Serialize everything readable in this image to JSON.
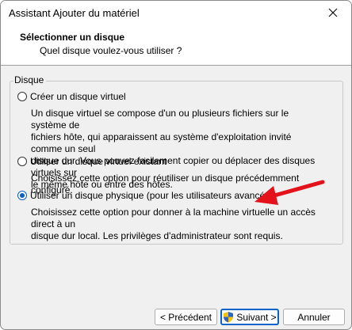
{
  "window": {
    "title": "Assistant Ajouter du matériel"
  },
  "header": {
    "title": "Sélectionner un disque",
    "subtitle": "Quel disque voulez-vous utiliser ?"
  },
  "group": {
    "legend": "Disque",
    "options": [
      {
        "label": "Créer un disque virtuel",
        "selected": false,
        "description": [
          "Un disque virtuel se compose d'un ou plusieurs fichiers sur le système de",
          "fichiers hôte, qui apparaissent au système d'exploitation invité comme un seul",
          "disque dur. Vous pouvez facilement copier ou déplacer des disques virtuels sur",
          "le même hôte ou entre des hôtes."
        ]
      },
      {
        "label": "Utiliser un disque virtuel existant",
        "selected": false,
        "description": [
          "Choisissez cette option pour réutiliser un disque précédemment configuré."
        ]
      },
      {
        "label": "Utiliser un disque physique (pour les utilisateurs avancés)",
        "selected": true,
        "description": [
          "Choisissez cette option pour donner à la machine virtuelle un accès direct à un",
          "disque dur local. Les privilèges d'administrateur sont requis."
        ]
      }
    ]
  },
  "buttons": {
    "back": "< Précédent",
    "next": "Suivant >",
    "cancel": "Annuler"
  },
  "annotation": {
    "arrow_color": "#e3121b"
  },
  "icons": {
    "close": "close-icon",
    "shield": "uac-shield-icon",
    "arrow": "red-arrow-annotation"
  }
}
